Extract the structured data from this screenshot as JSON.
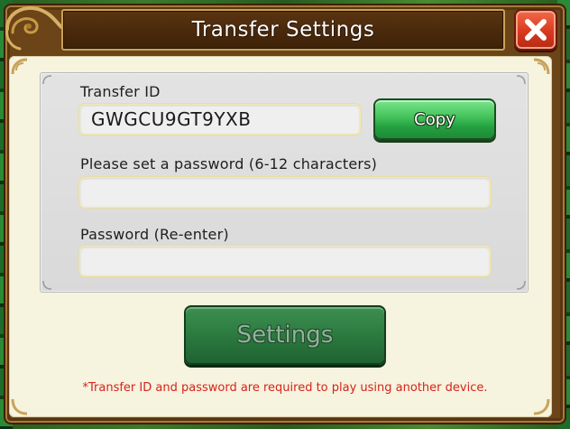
{
  "dialog": {
    "title": "Transfer Settings",
    "close_icon": "close-x-icon"
  },
  "form": {
    "transfer_id_label": "Transfer ID",
    "transfer_id_value": "GWGCU9GT9YXB",
    "copy_label": "Copy",
    "password_label": "Please set a password (6-12 characters)",
    "password_value": "",
    "password_reenter_label": "Password (Re-enter)",
    "password_reenter_value": ""
  },
  "actions": {
    "settings_label": "Settings",
    "settings_enabled": false
  },
  "note": "*Transfer ID and password are required to play using another device.",
  "colors": {
    "frame_brown": "#6b4418",
    "title_bg": "#4a2a0c",
    "close_red": "#d8391e",
    "copy_green": "#43c25a",
    "settings_green_disabled": "#2c7a40",
    "note_red": "#d6231a",
    "panel_cream": "#f6f3df"
  }
}
